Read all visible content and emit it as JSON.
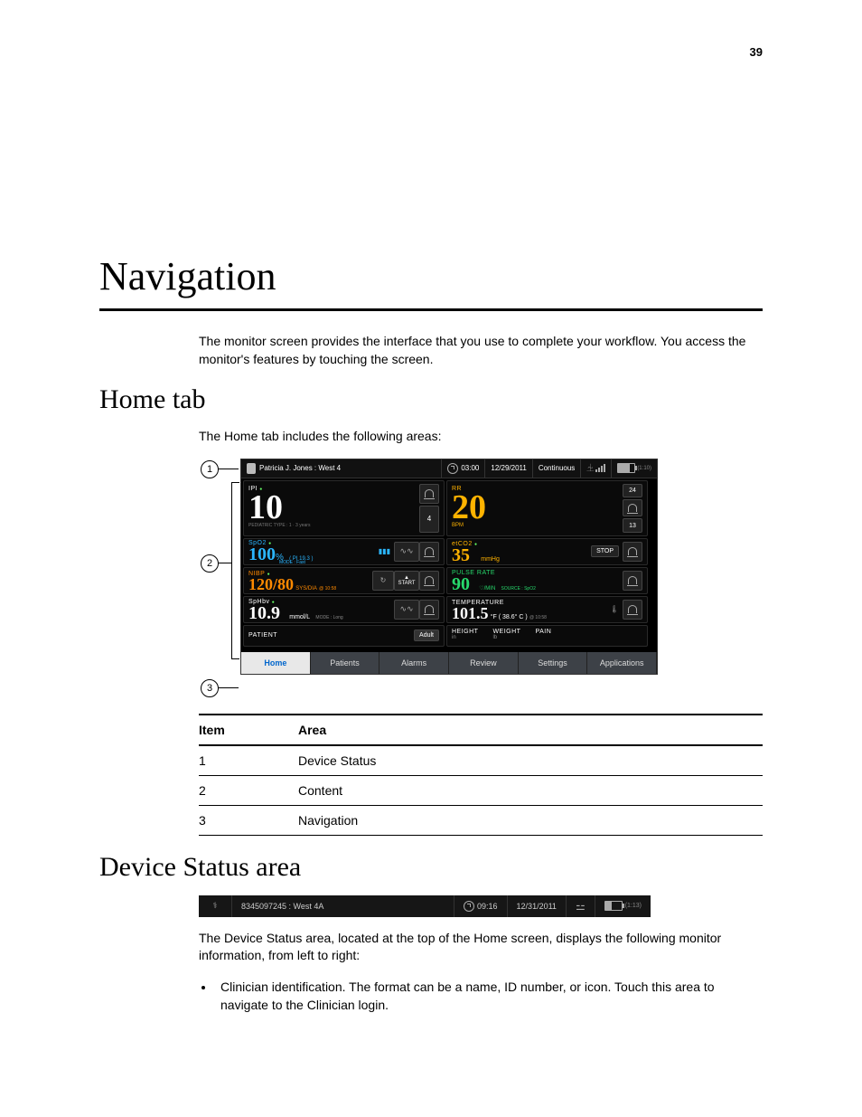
{
  "page_number": "39",
  "h1": "Navigation",
  "intro": "The monitor screen provides the interface that you use to complete your workflow. You access the monitor's features by touching the screen.",
  "h2_home": "Home tab",
  "home_intro": "The Home tab includes the following areas:",
  "callouts": [
    "1",
    "2",
    "3"
  ],
  "status_bar1": {
    "patient": "Patricia J. Jones : West 4",
    "time": "03:00",
    "date": "12/29/2011",
    "mode": "Continuous",
    "batt_text": "(1:10)"
  },
  "tiles": {
    "ipi": {
      "lbl": "IPI",
      "value": "10",
      "foot": "PEDIATRIC TYPE : 1 · 3 years",
      "limit": "4"
    },
    "rr": {
      "lbl": "RR",
      "value": "20",
      "unit": "BPM",
      "hi": "24",
      "lo": "13"
    },
    "spo2": {
      "lbl": "SpO2",
      "value": "100",
      "unit": "%",
      "pi": "( PI 19.3 )",
      "mode": "MODE : Fast"
    },
    "etco2": {
      "lbl": "etCO2",
      "value": "35",
      "unit": "mmHg",
      "btn": "STOP"
    },
    "nibp": {
      "lbl": "NIBP",
      "value": "120/80",
      "sub": "SYS/DIA",
      "time": "@ 10:58",
      "btn": "START"
    },
    "pulse": {
      "lbl": "PULSE RATE",
      "value": "90",
      "unit": "♡/MIN",
      "src": "SOURCE : SpO2"
    },
    "sphb": {
      "lbl": "SpHbv",
      "value": "10.9",
      "unit": "mmol/L",
      "mode": "MODE : Long"
    },
    "temp": {
      "lbl": "TEMPERATURE",
      "value": "101.5",
      "unit": "°F ( 38.6° C )",
      "time": "@ 10:58"
    },
    "patient_lbl": "PATIENT",
    "adult": "Adult",
    "hwp": {
      "h": "HEIGHT",
      "w": "WEIGHT",
      "p": "PAIN",
      "hu": "in",
      "wu": "lb"
    }
  },
  "nav_tabs": [
    "Home",
    "Patients",
    "Alarms",
    "Review",
    "Settings",
    "Applications"
  ],
  "table": {
    "head": [
      "Item",
      "Area"
    ],
    "rows": [
      [
        "1",
        "Device Status"
      ],
      [
        "2",
        "Content"
      ],
      [
        "3",
        "Navigation"
      ]
    ]
  },
  "h2_status": "Device Status area",
  "status_bar2": {
    "id": "8345097245 : West 4A",
    "time": "09:16",
    "date": "12/31/2011",
    "batt_text": "(1:13)"
  },
  "status_para": "The Device Status area, located at the top of the Home screen, displays the following monitor information, from left to right:",
  "bullet1": "Clinician identification. The format can be a name, ID number, or icon. Touch this area to navigate to the Clinician login."
}
